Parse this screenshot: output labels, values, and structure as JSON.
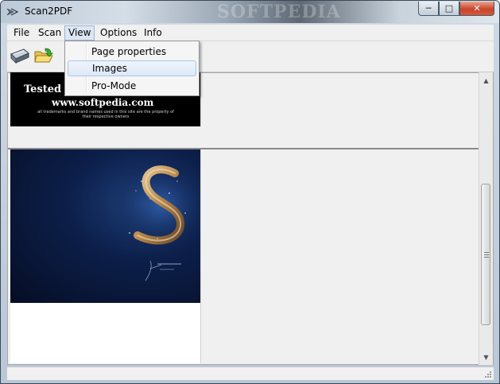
{
  "window": {
    "title": "Scan2PDF",
    "watermark": "SOFTPEDIA",
    "controls": {
      "minimize": "─",
      "maximize": "□",
      "close": "✕"
    }
  },
  "menubar": {
    "items": [
      "File",
      "Scan",
      "View",
      "Options",
      "Info"
    ],
    "active": "View"
  },
  "view_menu": {
    "items": [
      "Page properties",
      "Images",
      "Pro-Mode"
    ],
    "hovered": "Images"
  },
  "toolbar": {
    "buttons": [
      {
        "name": "scanner-icon"
      },
      {
        "name": "open-folder-icon"
      }
    ]
  },
  "pages": {
    "thumb1": {
      "heading": "Tested b",
      "url": "www.softpedia.com",
      "small_text": "all trademarks and brand names used in this site are the property of their respective owners"
    }
  },
  "scrollbar": {
    "up": "▲",
    "down": "▼"
  },
  "colors": {
    "accent": "#9fb4d6",
    "menu_hover": "#dde6f3",
    "close_button": "#c9452b"
  }
}
